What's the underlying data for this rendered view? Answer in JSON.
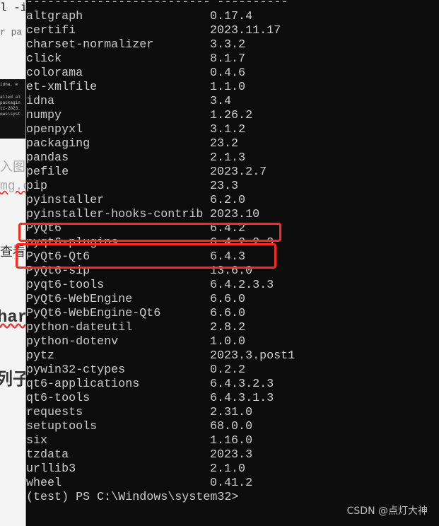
{
  "left_fragments": [
    "l -i",
    "r pa",
    "入图",
    "mg.c",
    "查看",
    "har",
    "列子"
  ],
  "left_image_lines": [
    "idna, e",
    "alled al",
    "packagin",
    "tz-2023.",
    "ows\\syst"
  ],
  "separator": "-------------------------- ----------",
  "packages": [
    {
      "name": "altgraph",
      "version": "0.17.4"
    },
    {
      "name": "certifi",
      "version": "2023.11.17"
    },
    {
      "name": "charset-normalizer",
      "version": "3.3.2"
    },
    {
      "name": "click",
      "version": "8.1.7"
    },
    {
      "name": "colorama",
      "version": "0.4.6"
    },
    {
      "name": "et-xmlfile",
      "version": "1.1.0"
    },
    {
      "name": "idna",
      "version": "3.4"
    },
    {
      "name": "numpy",
      "version": "1.26.2"
    },
    {
      "name": "openpyxl",
      "version": "3.1.2"
    },
    {
      "name": "packaging",
      "version": "23.2"
    },
    {
      "name": "pandas",
      "version": "2.1.3"
    },
    {
      "name": "pefile",
      "version": "2023.2.7"
    },
    {
      "name": "pip",
      "version": "23.3"
    },
    {
      "name": "pyinstaller",
      "version": "6.2.0"
    },
    {
      "name": "pyinstaller-hooks-contrib",
      "version": "2023.10"
    },
    {
      "name": "PyQt6",
      "version": "6.4.2"
    },
    {
      "name": "pyqt6-plugins",
      "version": "6.4.2.2.3"
    },
    {
      "name": "PyQt6-Qt6",
      "version": "6.4.3"
    },
    {
      "name": "PyQt6-sip",
      "version": "13.6.0"
    },
    {
      "name": "pyqt6-tools",
      "version": "6.4.2.3.3"
    },
    {
      "name": "PyQt6-WebEngine",
      "version": "6.6.0"
    },
    {
      "name": "PyQt6-WebEngine-Qt6",
      "version": "6.6.0"
    },
    {
      "name": "python-dateutil",
      "version": "2.8.2"
    },
    {
      "name": "python-dotenv",
      "version": "1.0.0"
    },
    {
      "name": "pytz",
      "version": "2023.3.post1"
    },
    {
      "name": "pywin32-ctypes",
      "version": "0.2.2"
    },
    {
      "name": "qt6-applications",
      "version": "6.4.3.2.3"
    },
    {
      "name": "qt6-tools",
      "version": "6.4.3.1.3"
    },
    {
      "name": "requests",
      "version": "2.31.0"
    },
    {
      "name": "setuptools",
      "version": "68.0.0"
    },
    {
      "name": "six",
      "version": "1.16.0"
    },
    {
      "name": "tzdata",
      "version": "2023.3"
    },
    {
      "name": "urllib3",
      "version": "2.1.0"
    },
    {
      "name": "wheel",
      "version": "0.41.2"
    }
  ],
  "prompt": "(test) PS C:\\Windows\\system32>",
  "watermark": "CSDN @点灯大神",
  "highlight_color": "#ff2a1f"
}
